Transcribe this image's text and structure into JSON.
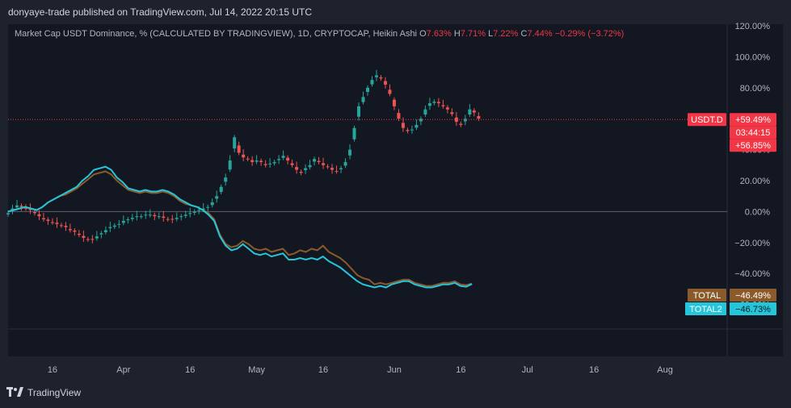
{
  "header": {
    "published": "donyaye-trade published on TradingView.com, Jul 14, 2022 20:15 UTC"
  },
  "legend": {
    "title": "Market Cap USDT Dominance, % (CALCULATED BY TRADINGVIEW), 1D, CRYPTOCAP, Heikin Ashi",
    "o_label": "O",
    "o_value": "7.63%",
    "h_label": "H",
    "h_value": "7.71%",
    "l_label": "L",
    "l_value": "7.22%",
    "c_label": "C",
    "c_value": "7.44%",
    "change": "−0.29% (−3.72%)"
  },
  "footer": {
    "brand": "TradingView"
  },
  "colors": {
    "background": "#131722",
    "up": "#26a69a",
    "down": "#ef5350",
    "total": "#8b5a2b",
    "total2": "#26c6da",
    "zero_line": "#5d606b",
    "price_line": "#f23645"
  },
  "chart_data": {
    "type": "candlestick_with_lines",
    "y_unit": "%",
    "y_ticks": [
      "120.00%",
      "100.00%",
      "80.00%",
      "60.00%",
      "40.00%",
      "20.00%",
      "0.00%",
      "−20.00%",
      "−40.00%",
      "−60.00%"
    ],
    "y_tick_values": [
      120,
      100,
      80,
      60,
      40,
      20,
      0,
      -20,
      -40,
      -60
    ],
    "ylim": [
      -68,
      120
    ],
    "x_ticks": [
      {
        "label": "16",
        "date": "2022-03-16"
      },
      {
        "label": "Apr",
        "date": "2022-04-01"
      },
      {
        "label": "16",
        "date": "2022-04-16"
      },
      {
        "label": "May",
        "date": "2022-05-01"
      },
      {
        "label": "16",
        "date": "2022-05-16"
      },
      {
        "label": "Jun",
        "date": "2022-06-01"
      },
      {
        "label": "16",
        "date": "2022-06-16"
      },
      {
        "label": "Jul",
        "date": "2022-07-01"
      },
      {
        "label": "16",
        "date": "2022-07-16"
      },
      {
        "label": "Aug",
        "date": "2022-08-01"
      }
    ],
    "x_range": [
      "2022-03-06",
      "2022-08-15"
    ],
    "series": [
      {
        "name": "USDT.D",
        "kind": "candles",
        "start_date": "2022-03-06",
        "closes": [
          -1,
          2,
          4,
          3,
          2,
          1,
          -1,
          -3,
          -5,
          -6,
          -7,
          -8,
          -9,
          -10,
          -12,
          -13,
          -15,
          -17,
          -18,
          -18,
          -16,
          -14,
          -12,
          -10,
          -9,
          -8,
          -6,
          -5,
          -4,
          -3,
          -3,
          -2,
          -2,
          -3,
          -3,
          -4,
          -5,
          -5,
          -4,
          -3,
          -2,
          -1,
          0,
          1,
          2,
          3,
          6,
          10,
          16,
          22,
          33,
          48,
          38,
          35,
          34,
          32,
          33,
          32,
          30,
          31,
          32,
          34,
          36,
          33,
          30,
          27,
          25,
          28,
          30,
          34,
          32,
          30,
          29,
          27,
          26,
          28,
          32,
          40,
          54,
          68,
          74,
          80,
          85,
          88,
          86,
          82,
          76,
          68,
          60,
          54,
          52,
          53,
          56,
          60,
          66,
          70,
          71,
          70,
          68,
          66,
          63,
          58,
          56,
          60,
          66,
          64,
          60
        ]
      },
      {
        "name": "TOTAL",
        "kind": "line",
        "start_date": "2022-03-06",
        "values": [
          0,
          1,
          2,
          3,
          2,
          1,
          3,
          6,
          8,
          10,
          11,
          13,
          15,
          18,
          21,
          24,
          25,
          26,
          24,
          20,
          17,
          14,
          13,
          12,
          13,
          12,
          12,
          13,
          12,
          10,
          7,
          5,
          4,
          3,
          1,
          -1,
          -5,
          -15,
          -21,
          -23,
          -22,
          -19,
          -21,
          -24,
          -25,
          -24,
          -26,
          -25,
          -24,
          -28,
          -27,
          -25,
          -26,
          -24,
          -25,
          -22,
          -26,
          -28,
          -30,
          -33,
          -37,
          -41,
          -43,
          -44,
          -47,
          -46,
          -47,
          -46,
          -45,
          -44,
          -44,
          -46,
          -47,
          -48,
          -48,
          -47,
          -46,
          -46,
          -45,
          -47,
          -47.5,
          -46.49
        ]
      },
      {
        "name": "TOTAL2",
        "kind": "line",
        "start_date": "2022-03-06",
        "values": [
          0,
          1,
          2,
          3,
          2,
          1,
          3,
          6,
          8,
          10,
          12,
          14,
          16,
          20,
          23,
          27,
          28,
          29,
          27,
          22,
          19,
          15,
          14,
          13,
          14,
          13,
          13,
          14,
          13,
          11,
          8,
          6,
          4,
          3,
          1,
          -2,
          -6,
          -16,
          -22,
          -25,
          -24,
          -21,
          -24,
          -27,
          -28,
          -27,
          -29,
          -28,
          -27,
          -31,
          -31,
          -30,
          -31,
          -30,
          -31,
          -29,
          -32,
          -34,
          -36,
          -39,
          -42,
          -45,
          -47,
          -48,
          -49,
          -48,
          -49,
          -47,
          -46,
          -45,
          -45,
          -47,
          -48,
          -49,
          -49,
          -48,
          -47,
          -47,
          -46,
          -48,
          -48.5,
          -46.73
        ]
      }
    ],
    "price_tags": [
      {
        "name": "USDT.D",
        "value": "+59.49%",
        "countdown": "03:44:15",
        "open": "+56.85%",
        "color": "#f23645"
      },
      {
        "name": "TOTAL",
        "value": "−46.49%",
        "color": "#8b5a2b"
      },
      {
        "name": "TOTAL2",
        "value": "−46.73%",
        "color": "#26c6da"
      }
    ]
  }
}
